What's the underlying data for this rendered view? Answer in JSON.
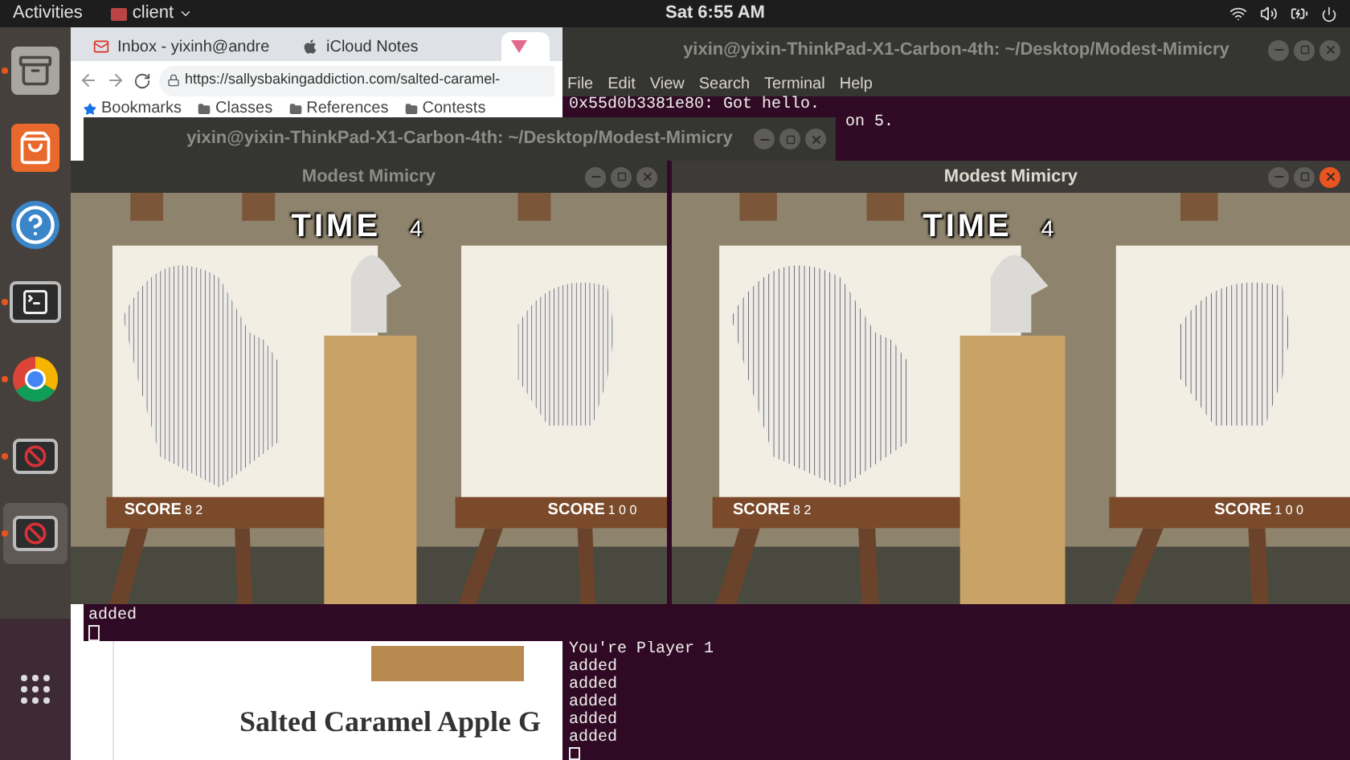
{
  "top_bar": {
    "activities": "Activities",
    "app_menu": "client",
    "clock": "Sat 6:55 AM"
  },
  "dock": {
    "items": [
      {
        "kind": "files",
        "running": true,
        "selected": false
      },
      {
        "kind": "store",
        "running": false,
        "selected": false
      },
      {
        "kind": "help",
        "running": false,
        "selected": false
      },
      {
        "kind": "terminal",
        "running": true,
        "selected": false
      },
      {
        "kind": "browser",
        "running": true,
        "selected": false
      },
      {
        "kind": "blocked",
        "running": true,
        "selected": false
      },
      {
        "kind": "blocked",
        "running": true,
        "selected": true
      }
    ]
  },
  "browser": {
    "tabs": [
      {
        "title": "Inbox - yixinh@andre",
        "selected": false
      },
      {
        "title": "iCloud Notes",
        "selected": false
      },
      {
        "selected": true
      }
    ],
    "url": "https://sallysbakingaddiction.com/salted-caramel-",
    "bookmarks": [
      "Bookmarks",
      "Classes",
      "References",
      "Contests"
    ],
    "heading": "Salted Caramel Apple G"
  },
  "terminal_back": {
    "title": "yixin@yixin-ThinkPad-X1-Carbon-4th: ~/Desktop/Modest-Mimicry",
    "focused": false,
    "menu": [
      "File",
      "Edit",
      "View",
      "Search",
      "Terminal",
      "Help"
    ],
    "lines_top": [
      "0x55d0b3381e80: Got hello.",
      "on 5."
    ],
    "lines_bottom": [
      "You're Player 1",
      "added",
      "added",
      "added",
      "added",
      "added"
    ]
  },
  "terminal_front": {
    "title": "yixin@yixin-ThinkPad-X1-Carbon-4th: ~/Desktop/Modest-Mimicry",
    "focused": false,
    "lines": [
      "added"
    ]
  },
  "game_windows": [
    {
      "title": "Modest Mimicry",
      "focused": false,
      "time_label": "TIME",
      "time": "4",
      "scores": [
        {
          "label": "SCORE",
          "value": "8 2"
        },
        {
          "label": "SCORE",
          "value": "1 0 0"
        }
      ]
    },
    {
      "title": "Modest Mimicry",
      "focused": true,
      "time_label": "TIME",
      "time": "4",
      "scores": [
        {
          "label": "SCORE",
          "value": "8 2"
        },
        {
          "label": "SCORE",
          "value": "1 0 0"
        }
      ]
    }
  ]
}
